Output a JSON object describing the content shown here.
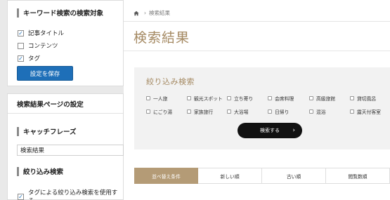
{
  "sidebar": {
    "target_section": {
      "title": "キーワード検索の検索対象",
      "options": [
        {
          "label": "記事タイトル",
          "checked": true
        },
        {
          "label": "コンテンツ",
          "checked": false
        },
        {
          "label": "タグ",
          "checked": true
        }
      ],
      "save_label": "設定を保存"
    },
    "results_settings": {
      "title": "検索結果ページの設定",
      "catchphrase_heading": "キャッチフレーズ",
      "catchphrase_value": "検索結果",
      "filter_heading": "絞り込み検索",
      "filter_option_label": "タグによる絞り込み検索を使用する",
      "filter_option_checked": true
    }
  },
  "preview": {
    "breadcrumb": {
      "current": "検索結果"
    },
    "page_title": "検索結果",
    "filter": {
      "title": "絞り込み検索",
      "tags": [
        "一人旅",
        "観光スポット",
        "立ち寄り",
        "会席料理",
        "高級旅館",
        "貸切風呂",
        "にごり湯",
        "家族旅行",
        "大浴場",
        "日帰り",
        "混浴",
        "露天付客室"
      ],
      "search_label": "検索する"
    },
    "sort_tabs": [
      {
        "label": "並べ替え条件",
        "active": true
      },
      {
        "label": "新しい順",
        "active": false
      },
      {
        "label": "古い順",
        "active": false
      },
      {
        "label": "閲覧数順",
        "active": false
      }
    ]
  },
  "colors": {
    "accent_gold": "#a58a63",
    "save_blue": "#1e6fb8",
    "sort_active": "#b49b76"
  }
}
